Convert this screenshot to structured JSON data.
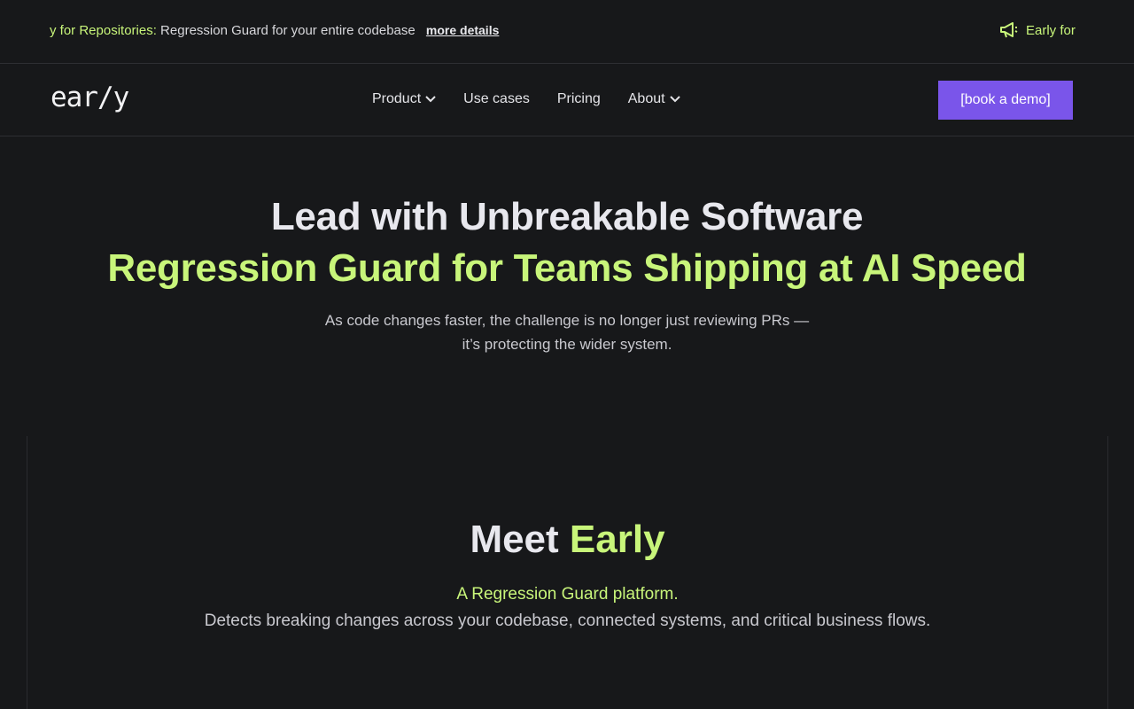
{
  "announcement": {
    "prefix": "y for Repositories:",
    "text": " Regression Guard for your entire codebase",
    "link": "more details",
    "right_text": "Early for",
    "icon": "megaphone-icon"
  },
  "nav": {
    "logo": "ear/y",
    "items": [
      {
        "label": "Product",
        "has_dropdown": true
      },
      {
        "label": "Use cases",
        "has_dropdown": false
      },
      {
        "label": "Pricing",
        "has_dropdown": false
      },
      {
        "label": "About",
        "has_dropdown": true
      }
    ],
    "cta": "[book a demo]"
  },
  "hero": {
    "title": "Lead with Unbreakable Software",
    "subtitle": "Regression Guard for Teams Shipping at AI Speed",
    "line1": "As code changes faster, the challenge is no longer just reviewing PRs —",
    "line2": "it’s protecting the wider system."
  },
  "meet": {
    "title_plain": "Meet ",
    "title_accent": "Early",
    "tagline": "A Regression Guard platform.",
    "description": "Detects breaking changes across your codebase, connected systems, and critical business flows."
  },
  "colors": {
    "background": "#17181a",
    "accent_green": "#c8f57a",
    "accent_purple": "#7a55ea"
  }
}
